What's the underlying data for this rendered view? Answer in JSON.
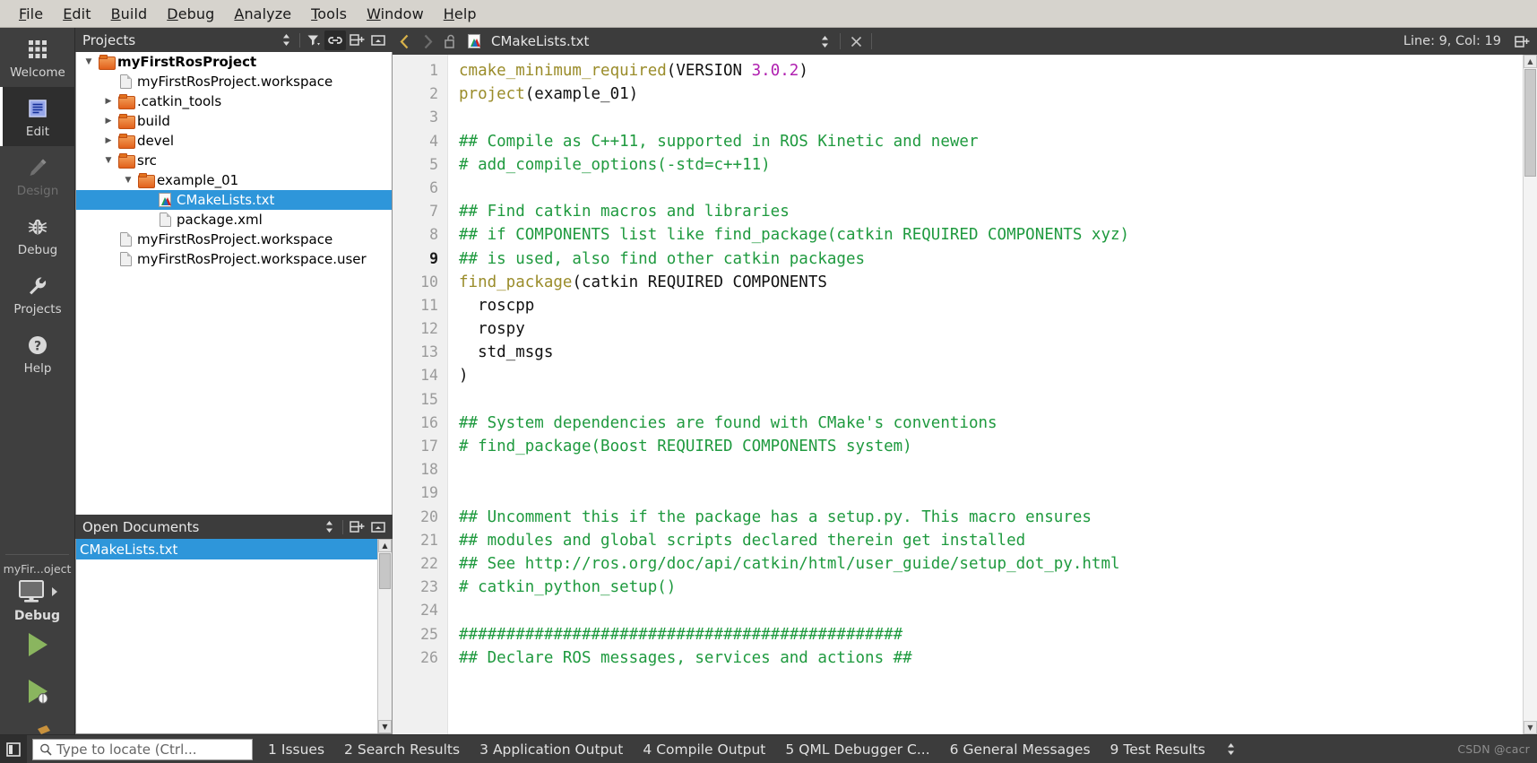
{
  "menubar": {
    "items": [
      {
        "label": "File",
        "accel": "F"
      },
      {
        "label": "Edit",
        "accel": "E"
      },
      {
        "label": "Build",
        "accel": "B"
      },
      {
        "label": "Debug",
        "accel": "D"
      },
      {
        "label": "Analyze",
        "accel": "A"
      },
      {
        "label": "Tools",
        "accel": "T"
      },
      {
        "label": "Window",
        "accel": "W"
      },
      {
        "label": "Help",
        "accel": "H"
      }
    ]
  },
  "modebar": {
    "modes": [
      {
        "label": "Welcome",
        "icon": "grid-icon",
        "state": "normal"
      },
      {
        "label": "Edit",
        "icon": "document-lines-icon",
        "state": "active"
      },
      {
        "label": "Design",
        "icon": "pencil-icon",
        "state": "disabled"
      },
      {
        "label": "Debug",
        "icon": "bug-icon",
        "state": "normal"
      },
      {
        "label": "Projects",
        "icon": "wrench-icon",
        "state": "normal"
      },
      {
        "label": "Help",
        "icon": "question-circle-icon",
        "state": "normal"
      }
    ],
    "kit": {
      "project_name": "myFir...oject",
      "build_config": "Debug",
      "target_icon": "desktop-monitor-icon",
      "arrow_icon": "chevron-right-icon"
    },
    "run_buttons": [
      {
        "name": "run-button",
        "icon": "play-triangle-icon"
      },
      {
        "name": "debug-button",
        "icon": "play-bug-icon"
      },
      {
        "name": "build-button",
        "icon": "hammer-icon"
      }
    ]
  },
  "projects_panel": {
    "title": "Projects",
    "header_buttons": [
      {
        "name": "sync-selector",
        "icon": "updown-chevrons-icon"
      },
      {
        "name": "filter-button",
        "icon": "filter-funnel-icon"
      },
      {
        "name": "link-with-editor-button",
        "icon": "chain-link-icon",
        "active": true
      },
      {
        "name": "split-button",
        "icon": "split-plus-icon"
      },
      {
        "name": "close-button",
        "icon": "minimize-box-icon"
      }
    ],
    "tree": [
      {
        "label": "myFirstRosProject",
        "indent": 0,
        "icon": "folder-icon",
        "arrow": "down",
        "bold": true,
        "selected": false
      },
      {
        "label": "myFirstRosProject.workspace",
        "indent": 1,
        "icon": "file-icon",
        "arrow": "none",
        "bold": false,
        "selected": false
      },
      {
        "label": ".catkin_tools",
        "indent": 1,
        "icon": "folder-icon",
        "arrow": "right",
        "bold": false,
        "selected": false
      },
      {
        "label": "build",
        "indent": 1,
        "icon": "folder-icon",
        "arrow": "right",
        "bold": false,
        "selected": false
      },
      {
        "label": "devel",
        "indent": 1,
        "icon": "folder-icon",
        "arrow": "right",
        "bold": false,
        "selected": false
      },
      {
        "label": "src",
        "indent": 1,
        "icon": "folder-icon",
        "arrow": "down",
        "bold": false,
        "selected": false
      },
      {
        "label": "example_01",
        "indent": 2,
        "icon": "folder-icon",
        "arrow": "down",
        "bold": false,
        "selected": false
      },
      {
        "label": "CMakeLists.txt",
        "indent": 3,
        "icon": "cmake-file-icon",
        "arrow": "none",
        "bold": false,
        "selected": true
      },
      {
        "label": "package.xml",
        "indent": 3,
        "icon": "file-icon",
        "arrow": "none",
        "bold": false,
        "selected": false
      },
      {
        "label": "myFirstRosProject.workspace",
        "indent": 1,
        "icon": "file-icon",
        "arrow": "none",
        "bold": false,
        "selected": false
      },
      {
        "label": "myFirstRosProject.workspace.user",
        "indent": 1,
        "icon": "file-icon",
        "arrow": "none",
        "bold": false,
        "selected": false
      }
    ]
  },
  "open_documents": {
    "title": "Open Documents",
    "header_buttons": [
      {
        "name": "sort-selector",
        "icon": "updown-chevrons-icon"
      },
      {
        "name": "split-button",
        "icon": "split-plus-icon"
      },
      {
        "name": "close-button",
        "icon": "minimize-box-icon"
      }
    ],
    "items": [
      {
        "label": "CMakeLists.txt",
        "selected": true
      }
    ]
  },
  "editor": {
    "toolbar": {
      "back_icon": "chevron-left-icon",
      "forward_icon": "chevron-right-icon",
      "lock_icon": "open-padlock-icon",
      "file_icon": "cmake-file-icon",
      "document_title": "CMakeLists.txt",
      "doc_selector_icon": "updown-chevrons-icon",
      "close_icon": "close-x-icon",
      "split_icon": "split-plus-icon",
      "cursor_position": "Line: 9, Col: 19"
    },
    "current_line": 9,
    "lines": [
      {
        "n": 1,
        "tokens": [
          {
            "t": "cmake_minimum_required",
            "c": "fn"
          },
          {
            "t": "(VERSION ",
            "c": "txt"
          },
          {
            "t": "3.0.2",
            "c": "num"
          },
          {
            "t": ")",
            "c": "txt"
          }
        ]
      },
      {
        "n": 2,
        "tokens": [
          {
            "t": "project",
            "c": "fn"
          },
          {
            "t": "(example_01)",
            "c": "txt"
          }
        ]
      },
      {
        "n": 3,
        "tokens": []
      },
      {
        "n": 4,
        "tokens": [
          {
            "t": "## Compile as C++11, supported in ROS Kinetic and newer",
            "c": "cmt"
          }
        ]
      },
      {
        "n": 5,
        "tokens": [
          {
            "t": "# add_compile_options(-std=c++11)",
            "c": "cmt"
          }
        ]
      },
      {
        "n": 6,
        "tokens": []
      },
      {
        "n": 7,
        "tokens": [
          {
            "t": "## Find catkin macros and libraries",
            "c": "cmt"
          }
        ]
      },
      {
        "n": 8,
        "tokens": [
          {
            "t": "## if COMPONENTS list like find_package(catkin REQUIRED COMPONENTS xyz)",
            "c": "cmt"
          }
        ]
      },
      {
        "n": 9,
        "tokens": [
          {
            "t": "## is used, also find other catkin packages",
            "c": "cmt"
          }
        ]
      },
      {
        "n": 10,
        "tokens": [
          {
            "t": "find_package",
            "c": "fn"
          },
          {
            "t": "(catkin REQUIRED COMPONENTS",
            "c": "txt"
          }
        ]
      },
      {
        "n": 11,
        "tokens": [
          {
            "t": "  roscpp",
            "c": "txt"
          }
        ]
      },
      {
        "n": 12,
        "tokens": [
          {
            "t": "  rospy",
            "c": "txt"
          }
        ]
      },
      {
        "n": 13,
        "tokens": [
          {
            "t": "  std_msgs",
            "c": "txt"
          }
        ]
      },
      {
        "n": 14,
        "tokens": [
          {
            "t": ")",
            "c": "txt"
          }
        ]
      },
      {
        "n": 15,
        "tokens": []
      },
      {
        "n": 16,
        "tokens": [
          {
            "t": "## System dependencies are found with CMake's conventions",
            "c": "cmt"
          }
        ]
      },
      {
        "n": 17,
        "tokens": [
          {
            "t": "# find_package(Boost REQUIRED COMPONENTS system)",
            "c": "cmt"
          }
        ]
      },
      {
        "n": 18,
        "tokens": []
      },
      {
        "n": 19,
        "tokens": []
      },
      {
        "n": 20,
        "tokens": [
          {
            "t": "## Uncomment this if the package has a setup.py. This macro ensures",
            "c": "cmt"
          }
        ]
      },
      {
        "n": 21,
        "tokens": [
          {
            "t": "## modules and global scripts declared therein get installed",
            "c": "cmt"
          }
        ]
      },
      {
        "n": 22,
        "tokens": [
          {
            "t": "## See http://ros.org/doc/api/catkin/html/user_guide/setup_dot_py.html",
            "c": "cmt"
          }
        ]
      },
      {
        "n": 23,
        "tokens": [
          {
            "t": "# catkin_python_setup()",
            "c": "cmt"
          }
        ]
      },
      {
        "n": 24,
        "tokens": []
      },
      {
        "n": 25,
        "tokens": [
          {
            "t": "###############################################",
            "c": "cmt"
          }
        ]
      },
      {
        "n": 26,
        "tokens": [
          {
            "t": "## Declare ROS messages, services and actions ##",
            "c": "cmt"
          }
        ]
      }
    ]
  },
  "statusbar": {
    "toggle_sidebar_icon": "sidebar-toggle-icon",
    "locator": {
      "icon": "search-icon",
      "placeholder": "Type to locate (Ctrl..."
    },
    "output_panes": [
      {
        "num": "1",
        "label": "Issues"
      },
      {
        "num": "2",
        "label": "Search Results"
      },
      {
        "num": "3",
        "label": "Application Output"
      },
      {
        "num": "4",
        "label": "Compile Output"
      },
      {
        "num": "5",
        "label": "QML Debugger C..."
      },
      {
        "num": "6",
        "label": "General Messages"
      },
      {
        "num": "9",
        "label": "Test Results"
      }
    ],
    "pane_selector_icon": "updown-chevrons-icon",
    "watermark": "CSDN @cacr"
  },
  "colors": {
    "accent_selection": "#2e96da",
    "chrome_dark": "#3c3c3c",
    "menubar_bg": "#d6d3cd",
    "comment_green": "#1f9a3f",
    "function_gold": "#9a8c2a",
    "number_magenta": "#b020b0",
    "run_green": "#8ab55f",
    "folder_orange": "#e2611c"
  }
}
